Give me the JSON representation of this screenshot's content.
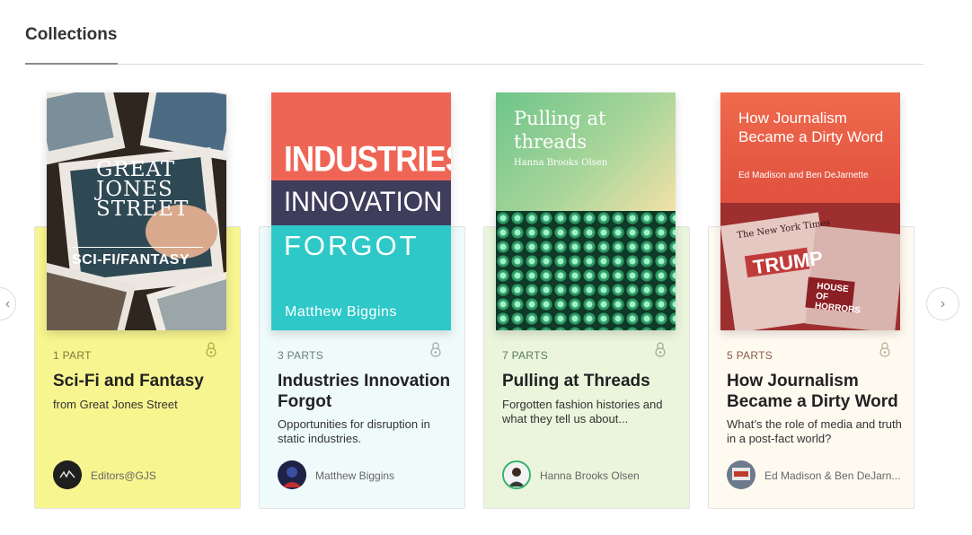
{
  "section": {
    "title": "Collections"
  },
  "cards": [
    {
      "cover_label": "SCI-FI/FANTASY",
      "cover_brand": [
        "GREAT",
        "JONES",
        "STREET"
      ],
      "parts": "1 PART",
      "title": "Sci-Fi and Fantasy",
      "description": "from Great Jones Street",
      "author": "Editors@GJS",
      "accent": "#f7f58f"
    },
    {
      "cover_lines": [
        "INDUSTRIES",
        "INNOVATION",
        "FORGOT"
      ],
      "cover_author": "Matthew Biggins",
      "parts": "3 PARTS",
      "title": "Industries Innovation Forgot",
      "description": "Opportunities for disruption in static industries.",
      "author": "Matthew Biggins",
      "accent": "#effbfb"
    },
    {
      "cover_title": "Pulling at threads",
      "cover_author": "Hanna Brooks Olsen",
      "parts": "7 PARTS",
      "title": "Pulling at Threads",
      "description": "Forgotten fashion histories and what they tell us about...",
      "author": "Hanna Brooks Olsen",
      "accent": "#eaf5dc"
    },
    {
      "cover_title": "How Journalism Became a Dirty Word",
      "cover_author": "Ed Madison and Ben DeJarnette",
      "cover_headline": "TRUMP",
      "cover_masthead": "The New York Times",
      "cover_subheadline": "HOUSE OF HORRORS",
      "parts": "5 PARTS",
      "title": "How Journalism Became a Dirty Word",
      "description": "What’s the role of media and truth in a post-fact world?",
      "author": "Ed Madison & Ben DeJarn...",
      "accent": "#fffaf0"
    }
  ],
  "nav": {
    "prev_icon": "chevron-left-icon",
    "next_icon": "chevron-right-icon"
  }
}
